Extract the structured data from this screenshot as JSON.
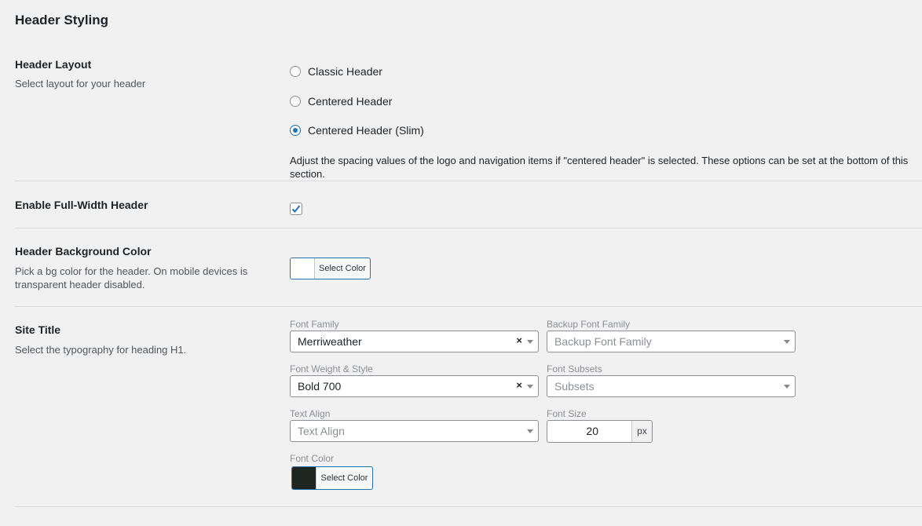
{
  "section_title": "Header Styling",
  "header_layout": {
    "label": "Header Layout",
    "desc": "Select layout for your header",
    "options": [
      "Classic Header",
      "Centered Header",
      "Centered Header (Slim)"
    ],
    "selected": "Centered Header (Slim)",
    "note": "Adjust the spacing values of the logo and navigation items if \"centered header\" is selected. These options can be set at the bottom of this section."
  },
  "full_width": {
    "label": "Enable Full-Width Header",
    "checked": true
  },
  "bg_color": {
    "label": "Header Background Color",
    "desc": "Pick a bg color for the header. On mobile devices is transparent header disabled.",
    "button_label": "Select Color",
    "swatch": "#ffffff"
  },
  "site_title": {
    "label": "Site Title",
    "desc": "Select the typography for heading H1.",
    "font_family": {
      "label": "Font Family",
      "value": "Merriweather"
    },
    "backup_font_family": {
      "label": "Backup Font Family",
      "placeholder": "Backup Font Family"
    },
    "font_weight": {
      "label": "Font Weight & Style",
      "value": "Bold 700"
    },
    "font_subsets": {
      "label": "Font Subsets",
      "placeholder": "Subsets"
    },
    "text_align": {
      "label": "Text Align",
      "placeholder": "Text Align"
    },
    "font_size": {
      "label": "Font Size",
      "value": "20",
      "unit": "px"
    },
    "font_color": {
      "label": "Font Color",
      "button_label": "Select Color",
      "swatch": "#1e2622"
    },
    "clear_glyph": "×"
  },
  "accent_color": "#2271b1"
}
